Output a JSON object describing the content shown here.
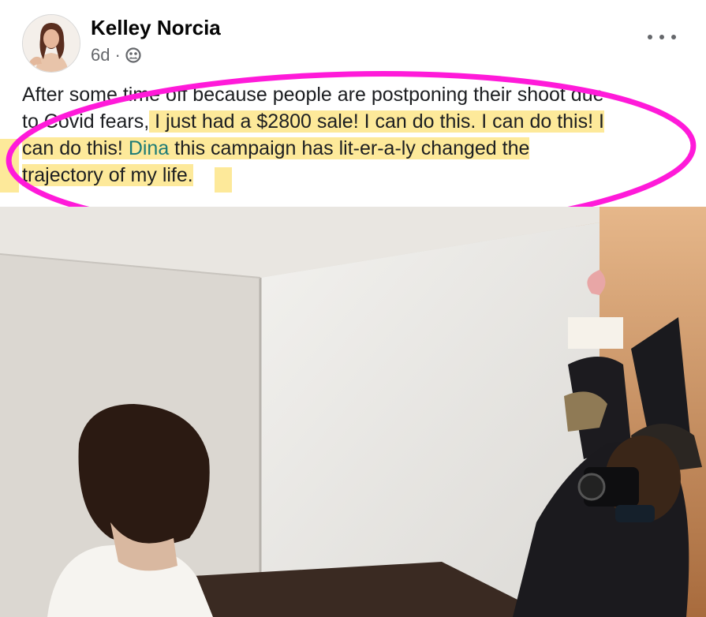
{
  "post": {
    "author": "Kelley Norcia",
    "timestamp": "6d",
    "separator": "·",
    "audience_icon": "friends-icon",
    "more_icon": "more-horizontal-icon",
    "text": {
      "line1": "After some time off because people are postponing their shoot due",
      "line2_plain": "to Covid fears,",
      "line2_highlight": " I just had a $2800 sale! I can do this. I can do this! I",
      "line3_start": "can do this! ",
      "mention": "Dina",
      "line3_end": " this campaign has lit-er-a-ly changed the",
      "line4": "trajectory of my life."
    }
  },
  "colors": {
    "highlight": "#fde99a",
    "annotation_circle": "#ff1ad9",
    "mention": "#1b7a76",
    "meta_text": "#65676b"
  }
}
